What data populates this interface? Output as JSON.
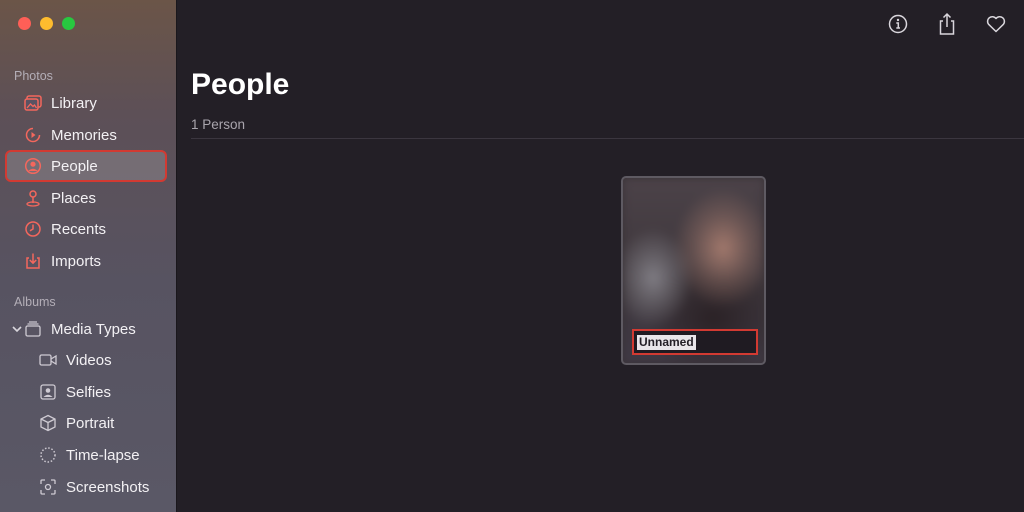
{
  "sidebar": {
    "sections": {
      "photos": "Photos",
      "albums": "Albums"
    },
    "items": [
      {
        "label": "Library",
        "icon": "library-icon"
      },
      {
        "label": "Memories",
        "icon": "memories-icon"
      },
      {
        "label": "People",
        "icon": "people-icon",
        "selected": true
      },
      {
        "label": "Places",
        "icon": "places-icon"
      },
      {
        "label": "Recents",
        "icon": "recents-icon"
      },
      {
        "label": "Imports",
        "icon": "imports-icon"
      }
    ],
    "albums": [
      {
        "label": "Media Types",
        "icon": "media-types-icon",
        "expanded": true
      },
      {
        "label": "Videos",
        "icon": "video-icon"
      },
      {
        "label": "Selfies",
        "icon": "selfies-icon"
      },
      {
        "label": "Portrait",
        "icon": "portrait-icon"
      },
      {
        "label": "Time-lapse",
        "icon": "timelapse-icon"
      },
      {
        "label": "Screenshots",
        "icon": "screenshots-icon"
      }
    ]
  },
  "main": {
    "title": "People",
    "subtitle": "1 Person",
    "people": [
      {
        "name": "Unnamed"
      }
    ]
  },
  "toolbar": {
    "icons": [
      "info-icon",
      "share-icon",
      "favorite-icon"
    ]
  },
  "colors": {
    "accent": "#f4675d",
    "highlight_border": "#d23a32",
    "background": "#231f26"
  }
}
